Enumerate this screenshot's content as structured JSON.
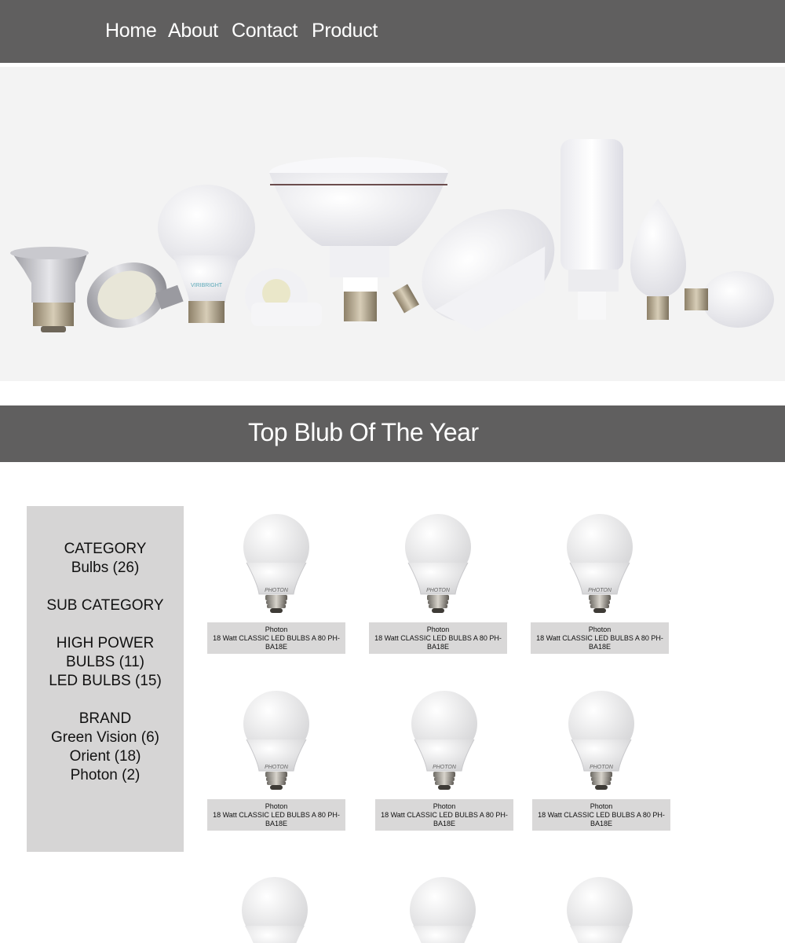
{
  "nav": {
    "items": [
      {
        "label": "Home"
      },
      {
        "label": "About"
      },
      {
        "label": "Contact"
      },
      {
        "label": "Product"
      }
    ]
  },
  "section": {
    "title": "Top Blub Of The Year"
  },
  "sidebar": {
    "category_heading": "CATEGORY",
    "category_items": [
      "Bulbs (26)"
    ],
    "subcategory_heading": "SUB CATEGORY",
    "subcategory_items": [
      "HIGH POWER BULBS (11)",
      "LED BULBS (15)"
    ],
    "brand_heading": "BRAND",
    "brand_items": [
      "Green Vision (6)",
      "Orient (18)",
      "Photon (2)"
    ]
  },
  "products": [
    {
      "brand": "Photon",
      "name": "18 Watt CLASSIC LED BULBS A 80 PH-BA18E",
      "bulb_label": "PHOTON"
    },
    {
      "brand": "Photon",
      "name": "18 Watt CLASSIC LED BULBS A 80 PH-BA18E",
      "bulb_label": "PHOTON"
    },
    {
      "brand": "Photon",
      "name": "18 Watt CLASSIC LED BULBS A 80 PH-BA18E",
      "bulb_label": "PHOTON"
    },
    {
      "brand": "Photon",
      "name": "18 Watt CLASSIC LED BULBS A 80 PH-BA18E",
      "bulb_label": "PHOTON"
    },
    {
      "brand": "Photon",
      "name": "18 Watt CLASSIC LED BULBS A 80 PH-BA18E",
      "bulb_label": "PHOTON"
    },
    {
      "brand": "Photon",
      "name": "18 Watt CLASSIC LED BULBS A 80 PH-BA18E",
      "bulb_label": "PHOTON"
    }
  ],
  "hero": {
    "bulb_brand_mark": "VIRIBRIGHT"
  },
  "colors": {
    "nav_bg": "#605f5f",
    "title_bar_bg": "#605f5f",
    "sidebar_bg": "#d6d5d5",
    "caption_bg": "#d9d8d8",
    "hero_bg": "#f3f3f3"
  }
}
